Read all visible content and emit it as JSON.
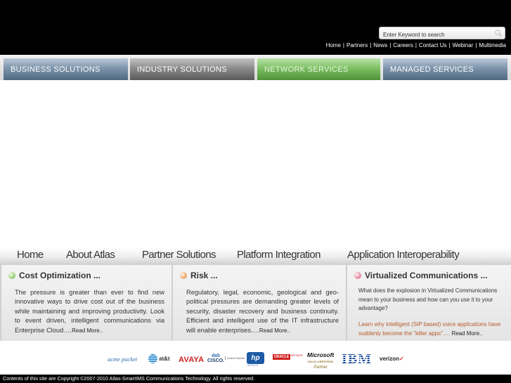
{
  "header": {
    "search_placeholder": "Enter Keyword to search",
    "top_links": [
      "Home",
      "Partners",
      "News",
      "Careers",
      "Contact Us",
      "Webinar",
      "Multimedia"
    ],
    "separator": "|"
  },
  "main_nav": {
    "business": "Business Solutions",
    "industry": "Industry Solutions",
    "network": "Network Services",
    "managed": "Managed Services"
  },
  "sub_nav": {
    "home": "Home",
    "about": "About Atlas",
    "partner": "Partner Solutions",
    "platform": "Platform Integration",
    "application": "Application Interoperability"
  },
  "panels": {
    "cost": {
      "title": "Cost Optimization ...",
      "body": "The pressure is greater than ever to find new innovative ways to drive cost out of the business while maintaining and improving productivity. Look to event driven, intelligent communications via Enterprise Cloud….",
      "more": "Read More.."
    },
    "risk": {
      "title": "Risk ...",
      "body": "Regulatory, legal, economic, geological and geo-political pressures are demanding greater levels of security, disaster recovery and business continuity. Efficient and intelligent use of the IT infrastructure will enable enterprises….",
      "more": "Read More.."
    },
    "virtual": {
      "title": "Virtualized Communications ...",
      "body": "What does the explosion in Virtualized Communications mean to your business and how can you use it to your advantage?",
      "link": "Learn why intelligent (SIP based) voice applications have suddenly become the \"killer apps\"….",
      "more": "Read More.."
    }
  },
  "logos": {
    "acme": "acme packet",
    "att": "at&t",
    "avaya": "AVAYA",
    "cisco": "CISCO.",
    "cisco_partner": "Select Partner",
    "hp": "hp",
    "hp_sub": "invent",
    "oracle": "ORACLE",
    "oracle_sub": "PARTNER",
    "ms_name": "Microsoft",
    "ms_gold": "GOLD CERTIFIED",
    "ms_partner": "Partner",
    "ibm": "IBM",
    "verizon": "verizon"
  },
  "footer": {
    "copyright": "Contents of this site are Copyright ©2007-2010 Atlas-SmartIMS Communications Technology. All rights reserved."
  },
  "colors": {
    "header_bg": "#000000",
    "business_tab": "#6d87a3",
    "industry_tab": "#7d7d7d",
    "network_tab": "#6fb356",
    "managed_tab": "#6d87a3",
    "link_orange": "#b5592a"
  }
}
